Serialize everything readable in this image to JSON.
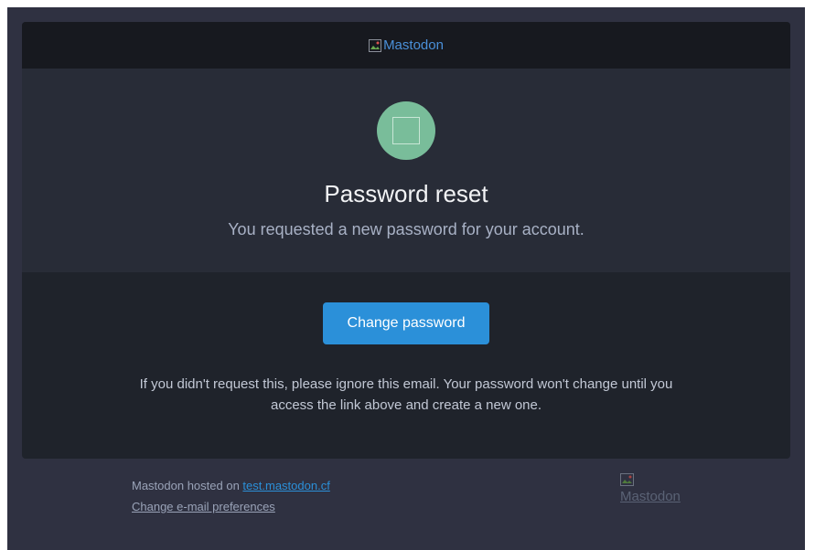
{
  "header": {
    "logo_alt": "Mastodon"
  },
  "hero": {
    "title": "Password reset",
    "subtitle": "You requested a new password for your account."
  },
  "body": {
    "button_label": "Change password",
    "note": "If you didn't request this, please ignore this email. Your password won't change until you access the link above and create a new one."
  },
  "footer": {
    "hosted_prefix": "Mastodon hosted on ",
    "host_link": "test.mastodon.cf",
    "preferences_link": "Change e-mail preferences",
    "logo_alt": "Mastodon"
  },
  "colors": {
    "background": "#2f3141",
    "card_header": "#17191f",
    "hero": "#282c37",
    "body": "#1f232b",
    "accent": "#2b90d9",
    "icon_circle": "#79bd9a"
  },
  "icons": {
    "header_logo": "broken-image-icon",
    "hero_icon": "password-reset-icon",
    "footer_logo": "broken-image-icon"
  }
}
